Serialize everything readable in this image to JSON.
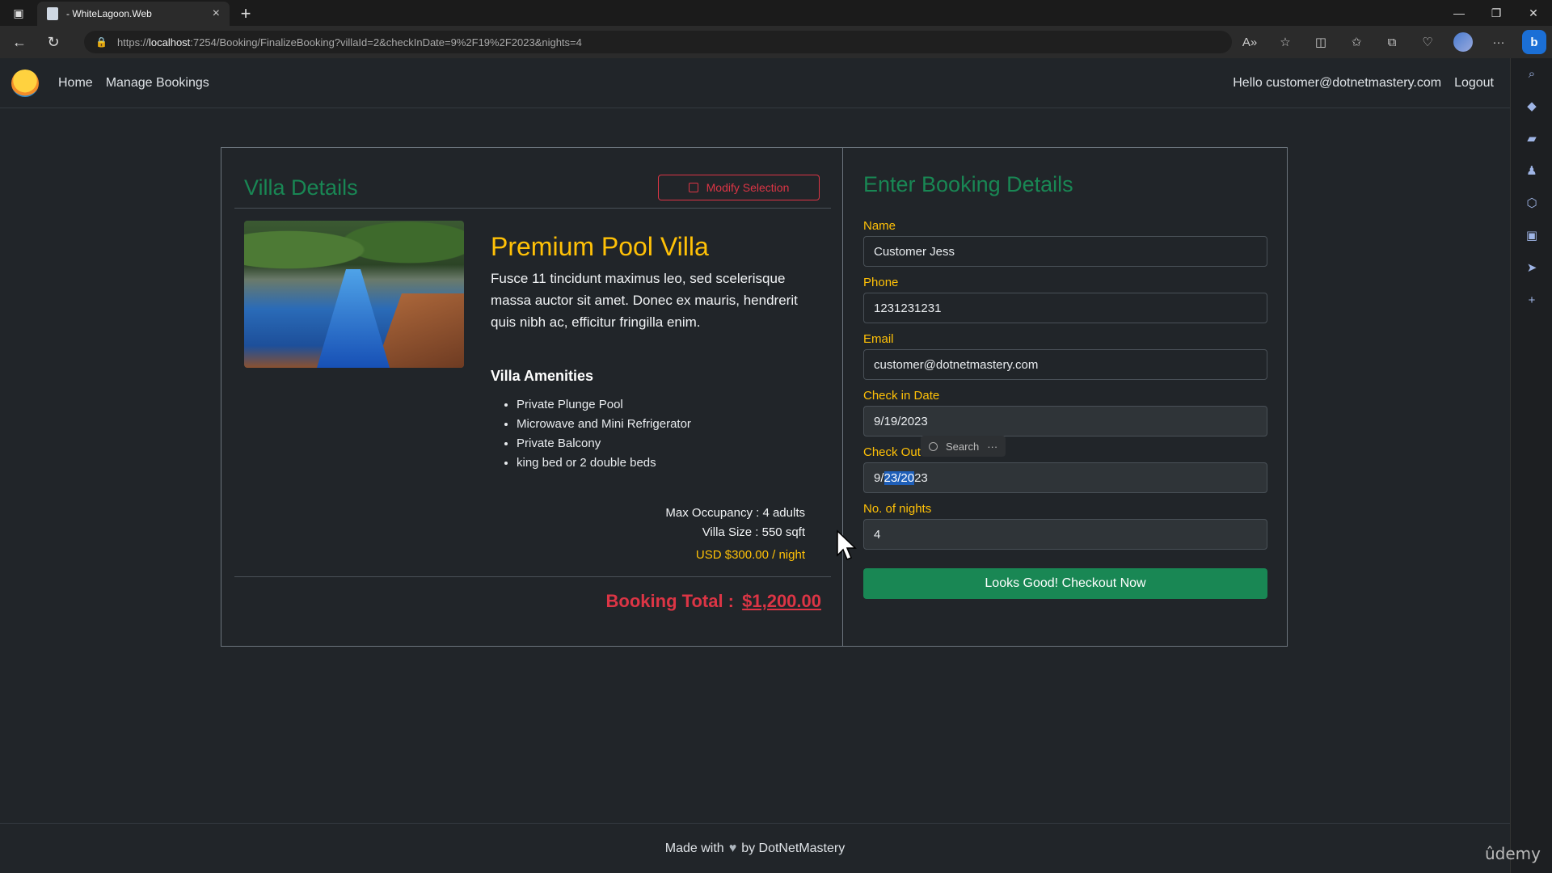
{
  "browser": {
    "tab_title": "- WhiteLagoon.Web",
    "url_prefix": "https://",
    "url_host": "localhost",
    "url_rest": ":7254/Booking/FinalizeBooking?villaId=2&checkInDate=9%2F19%2F2023&nights=4"
  },
  "nav": {
    "links": [
      "Home",
      "Manage Bookings"
    ],
    "greeting": "Hello customer@dotnetmastery.com",
    "logout": "Logout"
  },
  "villa": {
    "section_title": "Villa Details",
    "modify_label": "Modify Selection",
    "name": "Premium Pool Villa",
    "description": "Fusce 11 tincidunt maximus leo, sed scelerisque massa auctor sit amet. Donec ex mauris, hendrerit quis nibh ac, efficitur fringilla enim.",
    "amenities_title": "Villa Amenities",
    "amenities": [
      "Private Plunge Pool",
      "Microwave and Mini Refrigerator",
      "Private Balcony",
      "king bed or 2 double beds"
    ],
    "occupancy": "Max Occupancy : 4 adults",
    "size": "Villa Size : 550 sqft",
    "price": "USD $300.00 / night",
    "total_label": "Booking Total :",
    "total_amount": "$1,200.00"
  },
  "form": {
    "title": "Enter Booking Details",
    "name_label": "Name",
    "name_value": "Customer Jess",
    "phone_label": "Phone",
    "phone_value": "1231231231",
    "email_label": "Email",
    "email_value": "customer@dotnetmastery.com",
    "checkin_label": "Check in Date",
    "checkin_value": "9/19/2023",
    "checkout_label": "Check Out Date",
    "checkout_pre": "9/",
    "checkout_sel": "23/20",
    "checkout_post": "23",
    "nights_label": "No. of nights",
    "nights_value": "4",
    "submit_label": "Looks Good! Checkout Now"
  },
  "popup": {
    "search_label": "Search",
    "more": "···"
  },
  "footer": {
    "prefix": "Made with",
    "suffix": "by DotNetMastery"
  },
  "watermark": "ûdemy"
}
